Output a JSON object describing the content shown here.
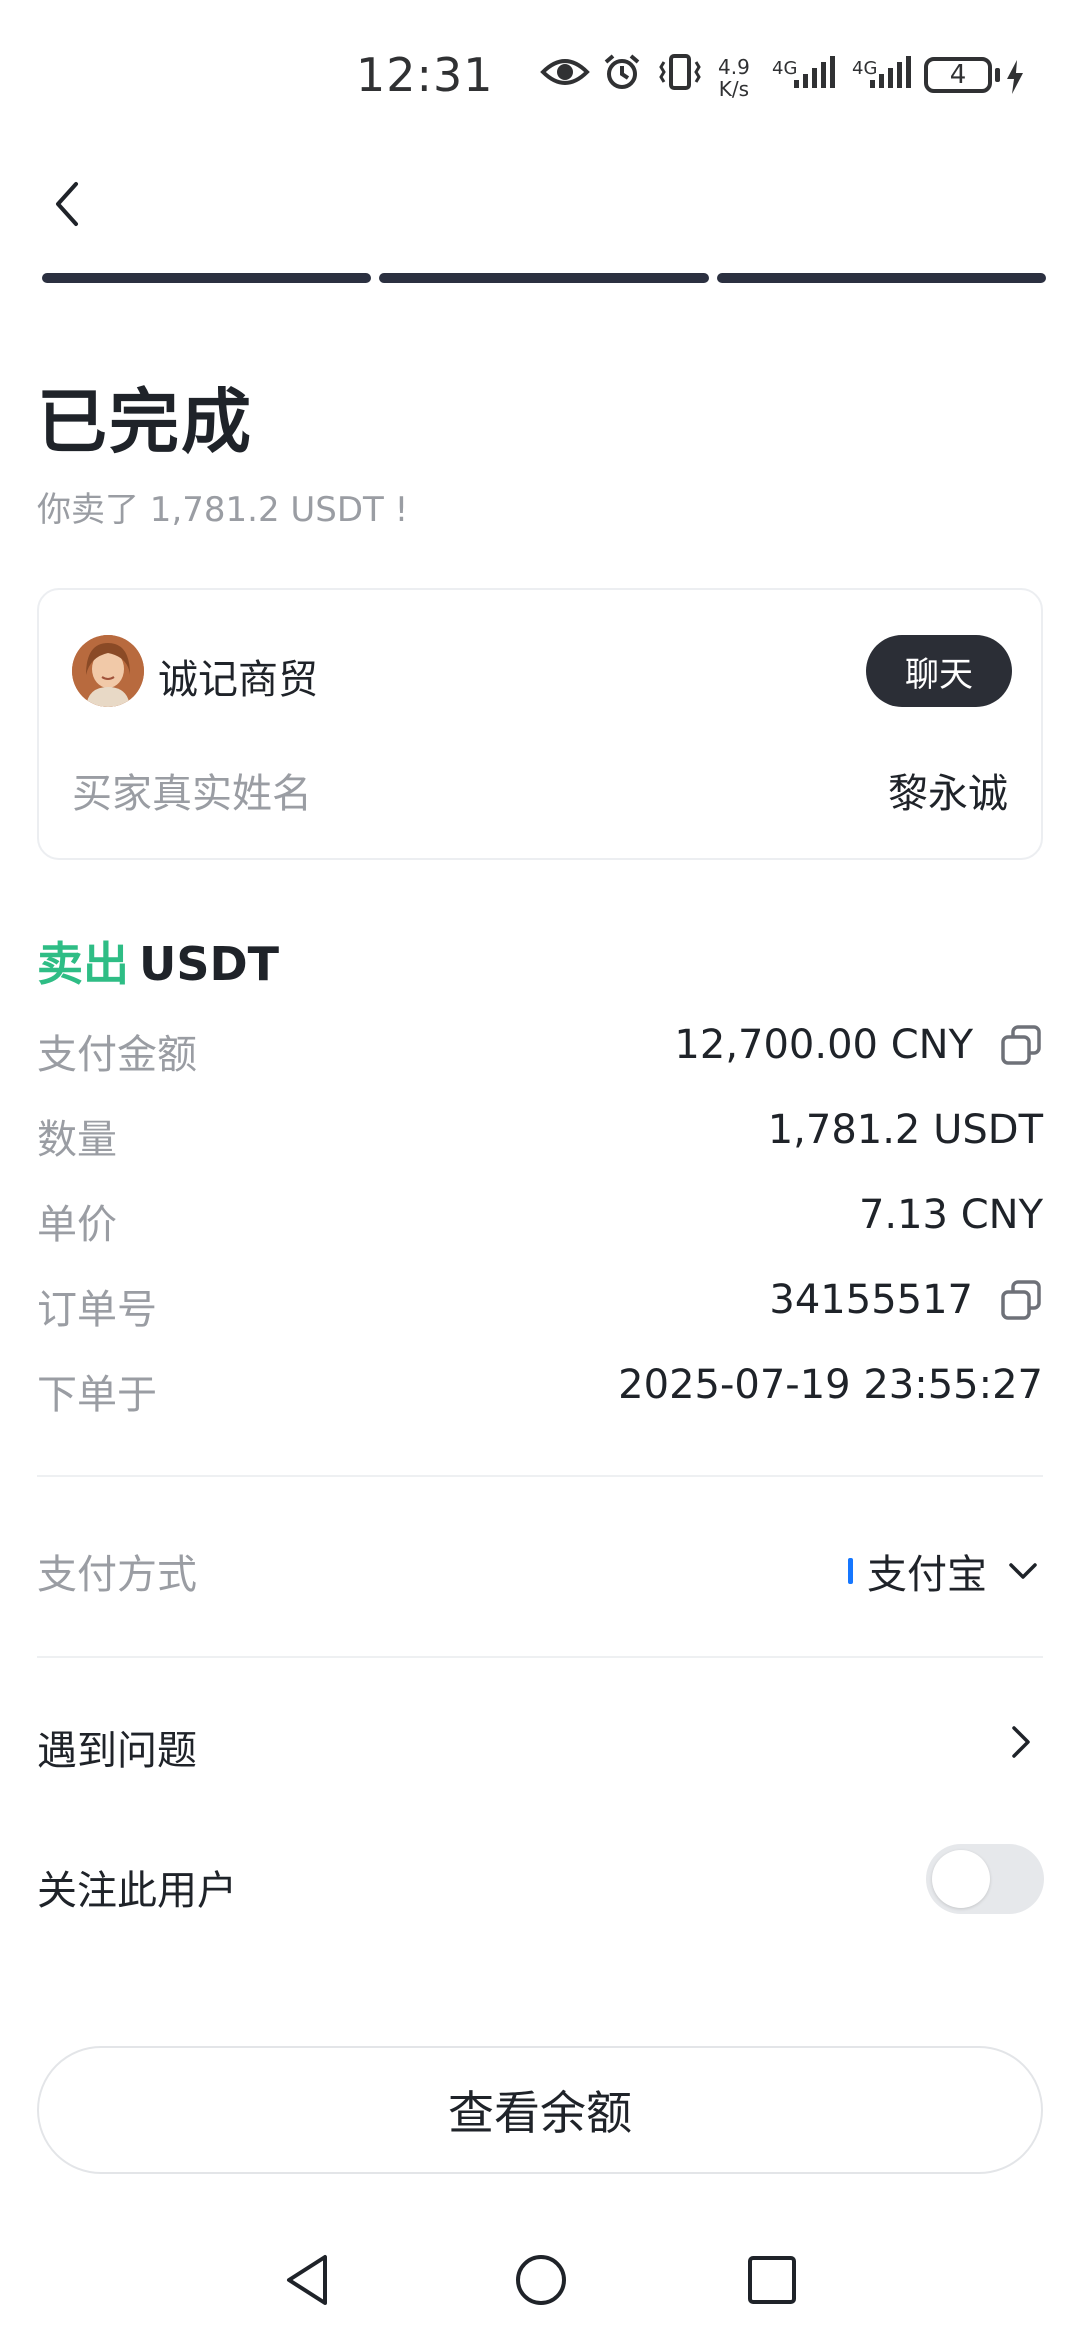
{
  "status_bar": {
    "time": "12:31",
    "net_speed_top": "4.9",
    "net_speed_bottom": "K/s",
    "sim1_label": "4G",
    "sim2_label": "4G",
    "battery_level": "4"
  },
  "header": {
    "progress_steps_total": 3,
    "progress_steps_done": 3
  },
  "order": {
    "status_title": "已完成",
    "status_subtitle": "你卖了 1,781.2 USDT !"
  },
  "counterparty": {
    "name": "诚记商贸",
    "chat_label": "聊天",
    "buyer_name_label": "买家真实姓名",
    "buyer_name_value": "黎永诚"
  },
  "trade": {
    "side": "卖出",
    "asset": "USDT",
    "side_color": "#2ebd85",
    "rows": [
      {
        "label": "支付金额",
        "value": "12,700.00 CNY"
      },
      {
        "label": "数量",
        "value": "1,781.2 USDT"
      },
      {
        "label": "单价",
        "value": "7.13 CNY"
      },
      {
        "label": "订单号",
        "value": "34155517"
      },
      {
        "label": "下单于",
        "value": "2025-07-19 23:55:27"
      }
    ]
  },
  "payment": {
    "label": "支付方式",
    "value": "支付宝",
    "accent_color": "#1677ff"
  },
  "menu": {
    "problem_label": "遇到问题",
    "follow_label": "关注此用户",
    "follow_enabled": false
  },
  "footer": {
    "balance_button_label": "查看余额"
  },
  "icons": {
    "back": "chevron-left-icon",
    "copy": "copy-icon",
    "dropdown": "chevron-down-icon",
    "forward": "chevron-right-icon"
  }
}
